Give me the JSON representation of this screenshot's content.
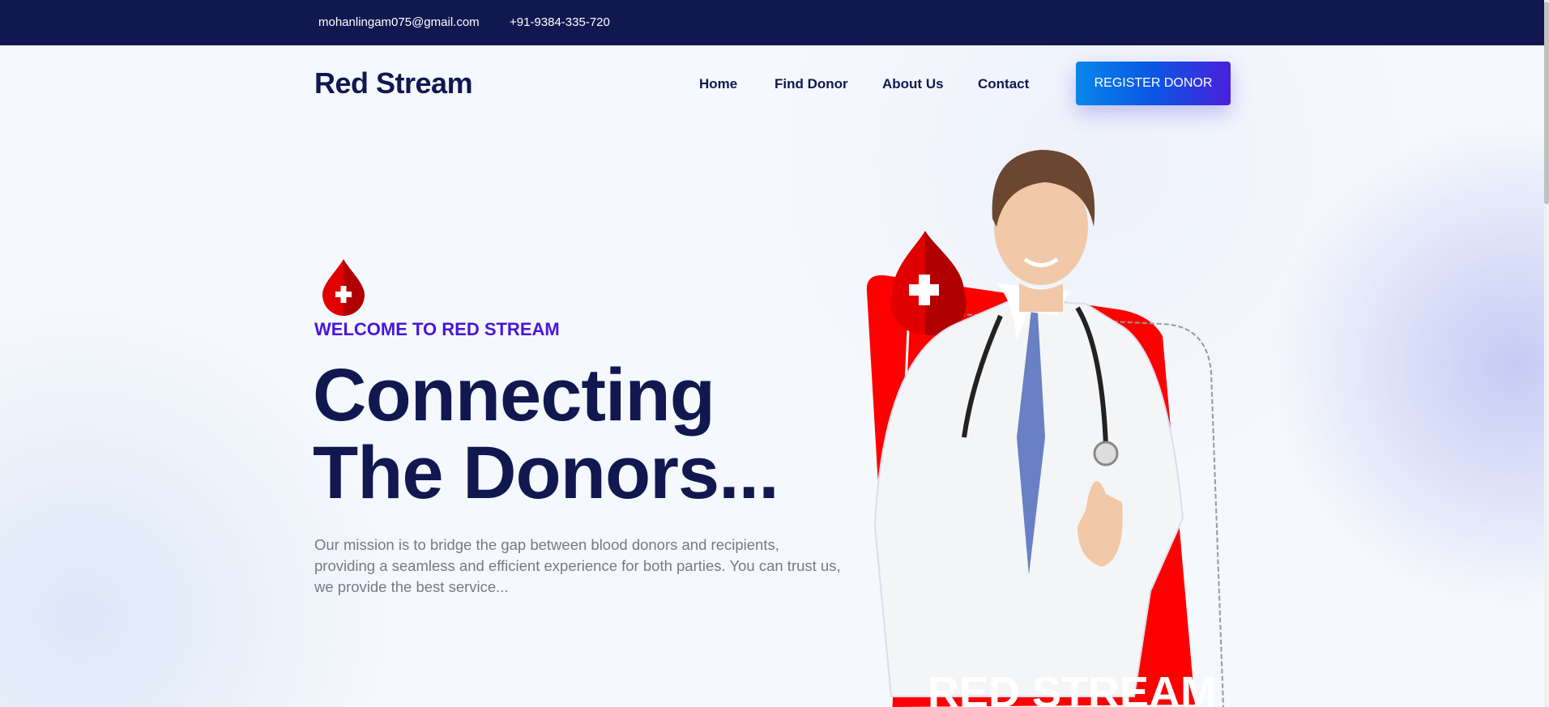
{
  "topbar": {
    "email": "mohanlingam075@gmail.com",
    "phone": "+91-9384-335-720"
  },
  "header": {
    "logo": "Red Stream",
    "nav": [
      "Home",
      "Find Donor",
      "About Us",
      "Contact"
    ],
    "register_label": "REGISTER DONOR"
  },
  "hero": {
    "eyebrow": "WELCOME TO RED STREAM",
    "title_line1": "Connecting",
    "title_line2": "The Donors...",
    "description": "Our mission is to bridge the gap between blood donors and recipients, providing a seamless and efficient experience for both parties. You can trust us, we provide the best service...",
    "card_text": "RED STREAM"
  },
  "colors": {
    "navy": "#111850",
    "accent": "#4816d8",
    "red": "#ff0000"
  }
}
